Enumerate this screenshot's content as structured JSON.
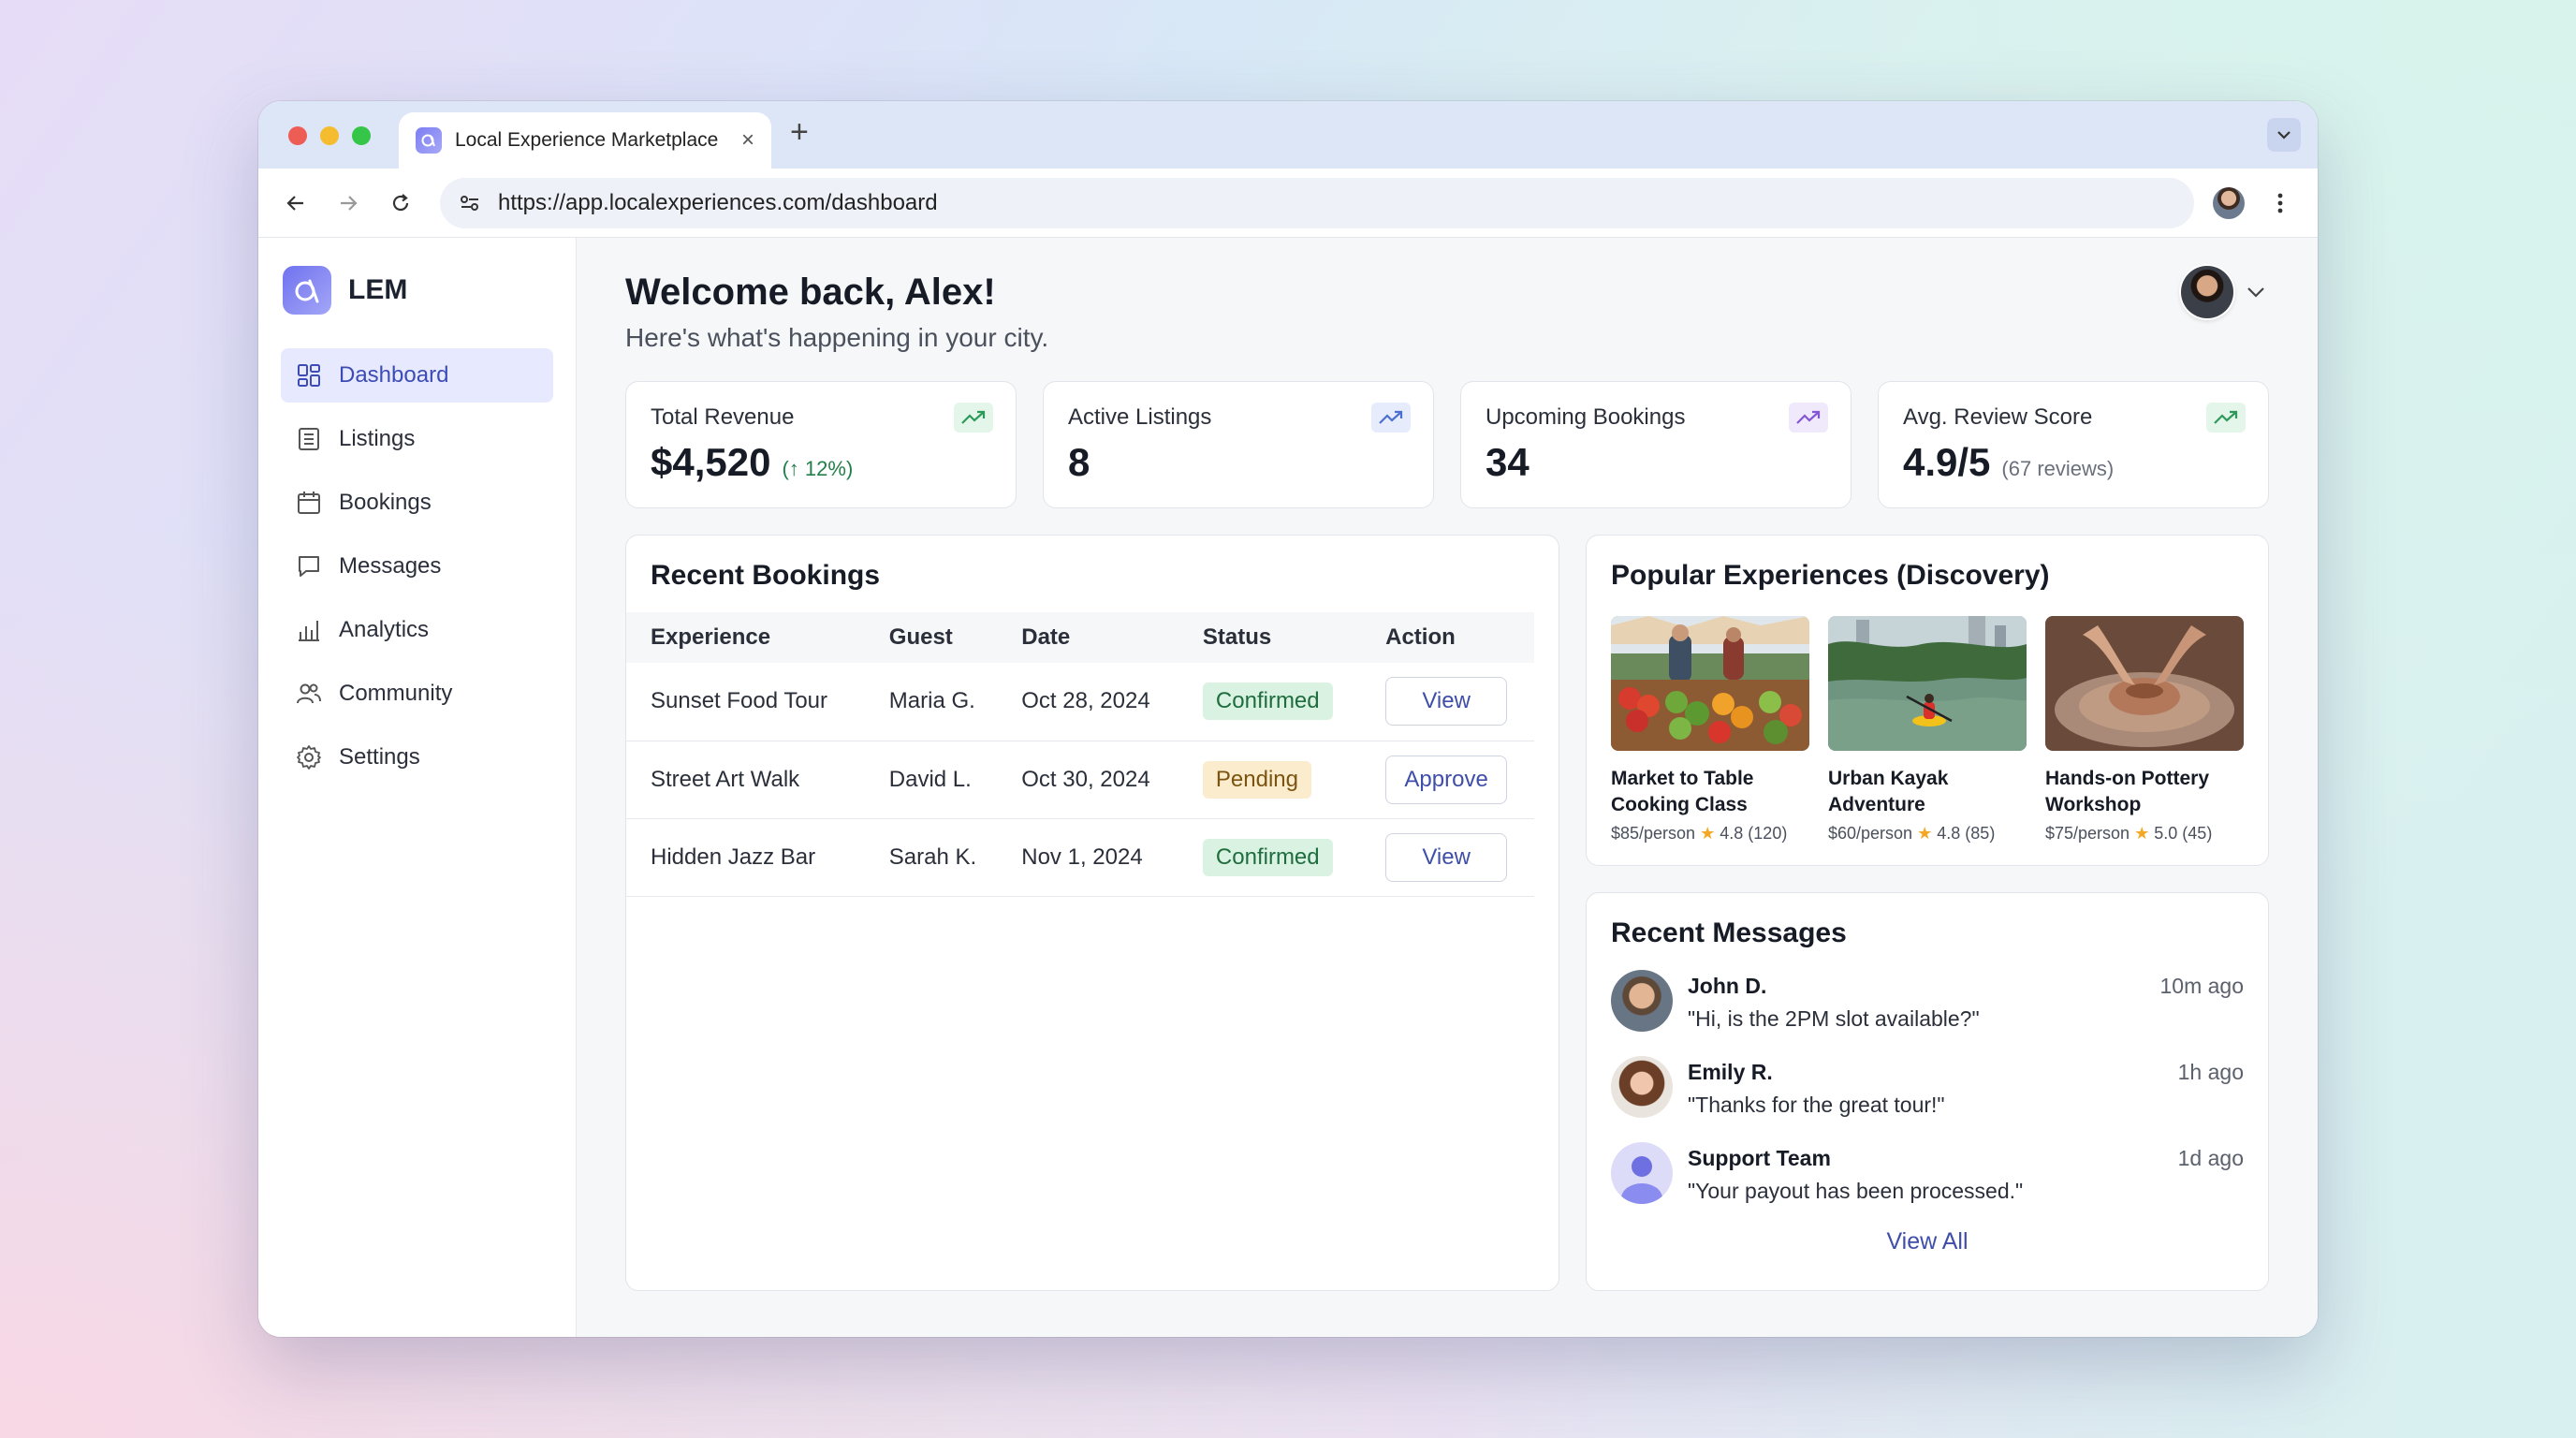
{
  "browser": {
    "tab_title": "Local Experience Marketplace",
    "url": "https://app.localexperiences.com/dashboard"
  },
  "sidebar": {
    "logo_text": "LEM",
    "items": [
      {
        "label": "Dashboard",
        "icon": "grid-icon",
        "active": true
      },
      {
        "label": "Listings",
        "icon": "list-icon"
      },
      {
        "label": "Bookings",
        "icon": "calendar-icon"
      },
      {
        "label": "Messages",
        "icon": "chat-icon"
      },
      {
        "label": "Analytics",
        "icon": "bar-chart-icon"
      },
      {
        "label": "Community",
        "icon": "users-icon"
      },
      {
        "label": "Settings",
        "icon": "gear-icon"
      }
    ]
  },
  "header": {
    "title": "Welcome back, Alex!",
    "subtitle": "Here's what's happening in your city."
  },
  "stats": [
    {
      "label": "Total Revenue",
      "value": "$4,520",
      "extra": "(↑ 12%)"
    },
    {
      "label": "Active Listings",
      "value": "8",
      "extra": ""
    },
    {
      "label": "Upcoming Bookings",
      "value": "34",
      "extra": ""
    },
    {
      "label": "Avg. Review Score",
      "value": "4.9/5",
      "extra": "(67 reviews)"
    }
  ],
  "bookings": {
    "title": "Recent Bookings",
    "columns": [
      "Experience",
      "Guest",
      "Date",
      "Status",
      "Action"
    ],
    "rows": [
      {
        "experience": "Sunset Food Tour",
        "guest": "Maria G.",
        "date": "Oct 28, 2024",
        "status": "Confirmed",
        "action": "View"
      },
      {
        "experience": "Street Art Walk",
        "guest": "David L.",
        "date": "Oct 30, 2024",
        "status": "Pending",
        "action": "Approve"
      },
      {
        "experience": "Hidden Jazz Bar",
        "guest": "Sarah K.",
        "date": "Nov 1, 2024",
        "status": "Confirmed",
        "action": "View"
      }
    ]
  },
  "popular": {
    "title": "Popular Experiences (Discovery)",
    "items": [
      {
        "title": "Market to Table Cooking Class",
        "price": "$85/person",
        "rating": "4.8",
        "reviews": "(120)"
      },
      {
        "title": "Urban Kayak Adventure",
        "price": "$60/person",
        "rating": "4.8",
        "reviews": "(85)"
      },
      {
        "title": "Hands-on Pottery Workshop",
        "price": "$75/person",
        "rating": "5.0",
        "reviews": "(45)"
      }
    ]
  },
  "messages": {
    "title": "Recent Messages",
    "items": [
      {
        "name": "John D.",
        "text": "\"Hi, is the 2PM slot available?\"",
        "time": "10m ago"
      },
      {
        "name": "Emily R.",
        "text": "\"Thanks for the great tour!\"",
        "time": "1h ago"
      },
      {
        "name": "Support Team",
        "text": "\"Your payout has been processed.\"",
        "time": "1d ago"
      }
    ],
    "view_all": "View All"
  },
  "colors": {
    "accent": "#3f4ea8",
    "active_bg": "#e7eaff",
    "confirmed_bg": "#d9f2e1",
    "pending_bg": "#fbeccd",
    "positive": "#22804a"
  }
}
